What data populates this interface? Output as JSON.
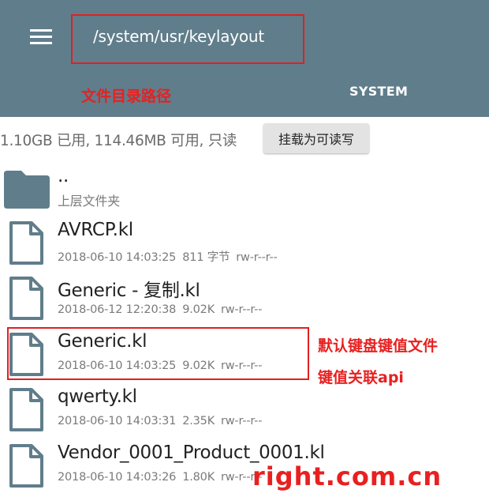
{
  "appbar": {
    "path": "/system/usr/keylayout",
    "tab_label": "SYSTEM",
    "color": "#607d8b"
  },
  "annotations": {
    "path_label": "文件目录路径",
    "file_label_line1": "默认键盘键值文件",
    "file_label_line2": "键值关联api",
    "watermark": "right.com.cn",
    "color": "#e82020"
  },
  "storage": {
    "info": "1.10GB 已用, 114.46MB 可用, 只读",
    "mount_button": "挂载为可读写"
  },
  "files": [
    {
      "icon": "folder-icon",
      "name": "..",
      "subtitle": "上层文件夹"
    },
    {
      "icon": "file-icon",
      "name": "AVRCP.kl",
      "date": "2018-06-10 14:03:25",
      "size": "811 字节",
      "perms": "rw-r--r--"
    },
    {
      "icon": "file-icon",
      "name": "Generic - 复制.kl",
      "date": "2018-06-12 12:20:38",
      "size": "9.02K",
      "perms": "rw-r--r--"
    },
    {
      "icon": "file-icon",
      "name": "Generic.kl",
      "date": "2018-06-10 14:03:25",
      "size": "9.02K",
      "perms": "rw-r--r--"
    },
    {
      "icon": "file-icon",
      "name": "qwerty.kl",
      "date": "2018-06-10 14:03:31",
      "size": "2.35K",
      "perms": "rw-r--r--"
    },
    {
      "icon": "file-icon",
      "name": "Vendor_0001_Product_0001.kl",
      "date": "2018-06-10 14:03:26",
      "size": "1.80K",
      "perms": "rw-r--r--"
    }
  ]
}
